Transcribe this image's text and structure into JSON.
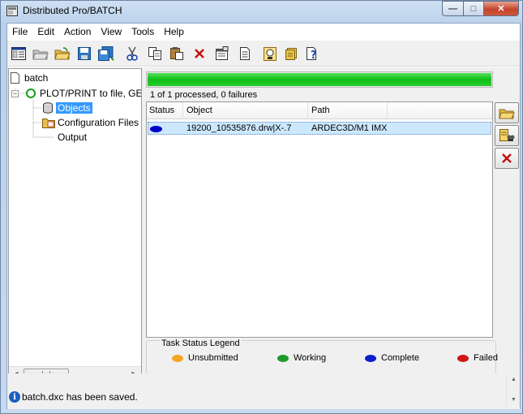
{
  "window": {
    "title": "Distributed Pro/BATCH",
    "caption_min": "—",
    "caption_max": "□",
    "caption_close": "✕"
  },
  "menu": [
    "File",
    "Edit",
    "Action",
    "View",
    "Tools",
    "Help"
  ],
  "toolbar": {
    "icons": [
      "properties-icon",
      "open-folder-gray-icon",
      "open-folder-icon",
      "save-icon",
      "save-as-icon",
      "cut-icon",
      "copy-icon",
      "paste-icon",
      "delete-icon",
      "properties-sheet-icon",
      "document-icon",
      "run-task-icon",
      "notes-icon",
      "help-icon"
    ]
  },
  "tree": {
    "root": "batch",
    "task": "PLOT/PRINT to file, GEN",
    "children": [
      "Objects",
      "Configuration Files",
      "Output"
    ],
    "selected": "Objects"
  },
  "progress": {
    "fraction": 1.0,
    "text": "1 of 1 processed, 0 failures"
  },
  "list": {
    "columns": [
      "Status",
      "Object",
      "Path"
    ],
    "rows": [
      {
        "status_color": "#0000cc",
        "object": "19200_10535876.drw|X-.7",
        "path": "ARDEC3D/M1 IMX"
      }
    ]
  },
  "side_buttons": [
    "add-folder-icon",
    "find-object-icon",
    "remove-icon"
  ],
  "legend": {
    "title": "Task Status Legend",
    "items": [
      {
        "label": "Unsubmitted",
        "color": "#f5a623"
      },
      {
        "label": "Working",
        "color": "#1e9b2a"
      },
      {
        "label": "Complete",
        "color": "#0a1ecc"
      },
      {
        "label": "Failed",
        "color": "#d01616"
      }
    ]
  },
  "statusbar": {
    "message": "batch.dxc has been saved."
  }
}
